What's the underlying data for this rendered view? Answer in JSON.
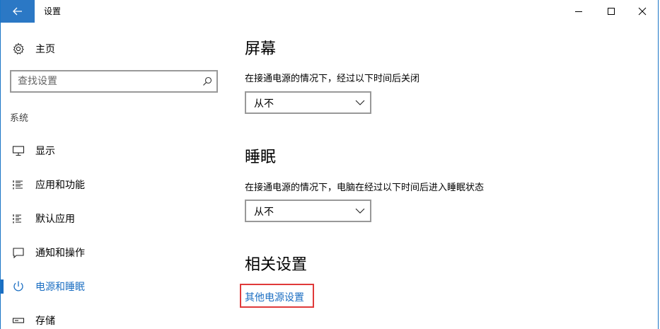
{
  "window": {
    "title": "设置"
  },
  "sidebar": {
    "home_label": "主页",
    "search_placeholder": "查找设置",
    "section_label": "系统",
    "items": [
      {
        "label": "显示",
        "icon": "monitor-icon"
      },
      {
        "label": "应用和功能",
        "icon": "list-icon"
      },
      {
        "label": "默认应用",
        "icon": "default-apps-icon"
      },
      {
        "label": "通知和操作",
        "icon": "notification-icon"
      },
      {
        "label": "电源和睡眠",
        "icon": "power-icon",
        "active": true
      },
      {
        "label": "存储",
        "icon": "storage-icon"
      }
    ]
  },
  "main": {
    "screen": {
      "heading": "屏幕",
      "description": "在接通电源的情况下，经过以下时间后关闭",
      "selected": "从不"
    },
    "sleep": {
      "heading": "睡眠",
      "description": "在接通电源的情况下，电脑在经过以下时间后进入睡眠状态",
      "selected": "从不"
    },
    "related": {
      "heading": "相关设置",
      "link": "其他电源设置"
    }
  },
  "colors": {
    "accent": "#1b6ec2",
    "back_button": "#2b78c5",
    "highlight_box": "#e03a3a"
  }
}
